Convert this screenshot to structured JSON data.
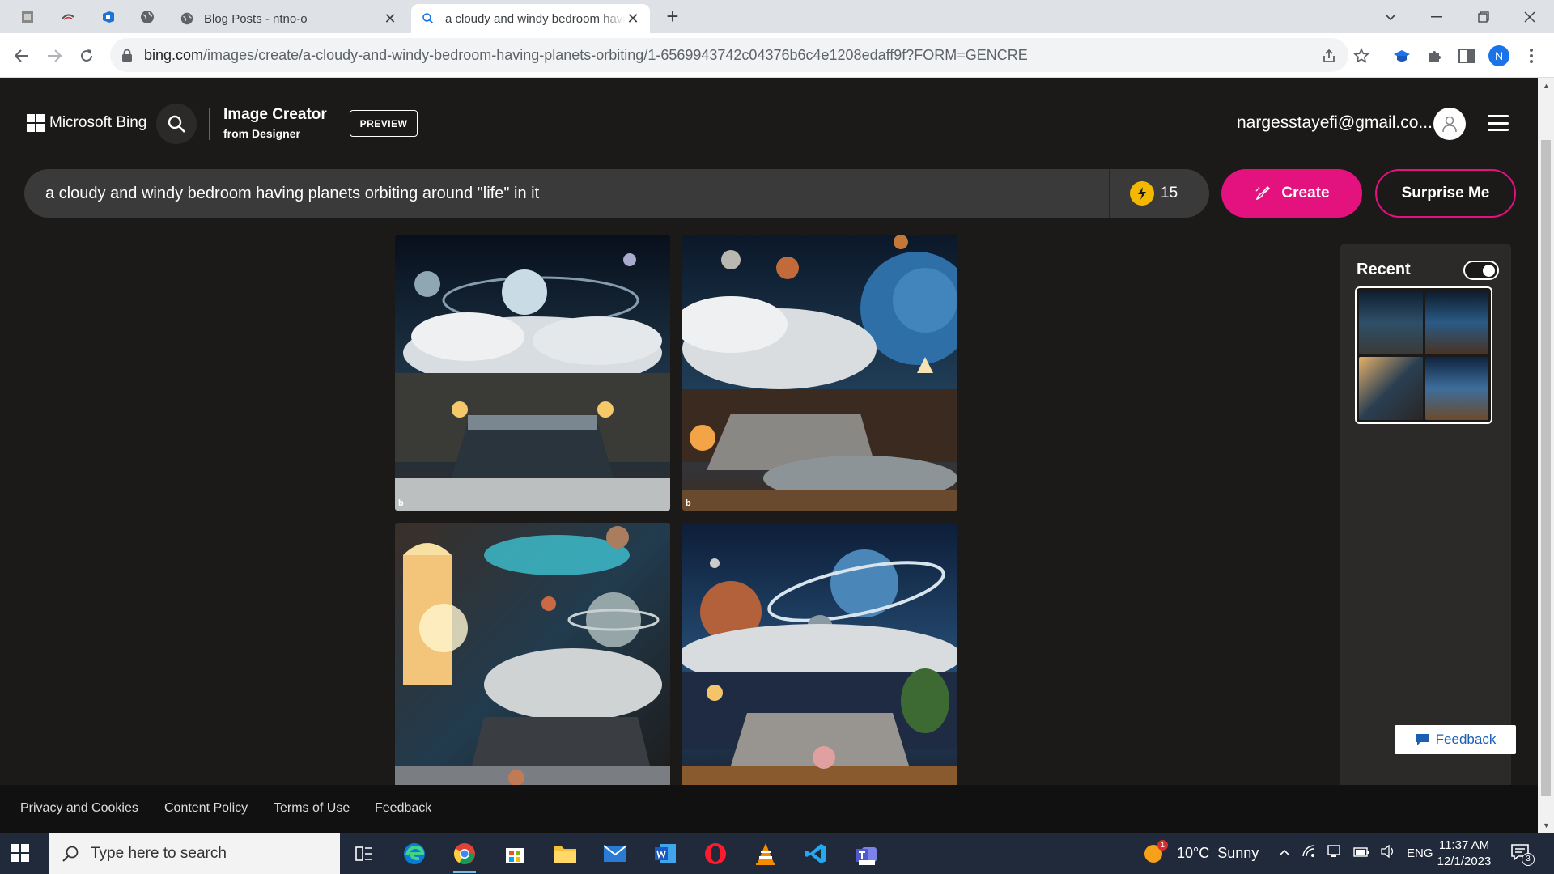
{
  "browser": {
    "tabs": [
      {
        "title": "Blog Posts - ntno-o",
        "active": false
      },
      {
        "title": "a cloudy and windy bedroom having planets orbiting",
        "active": true
      }
    ],
    "url_host": "bing.com",
    "url_path": "/images/create/a-cloudy-and-windy-bedroom-having-planets-orbiting/1-6569943742c04376b6c4e1208edaff9f?FORM=GENCRE",
    "profile_initial": "N"
  },
  "header": {
    "brand": "Microsoft Bing",
    "title": "Image Creator",
    "subtitle": "from Designer",
    "badge": "PREVIEW",
    "email": "nargesstayefi@gmail.co..."
  },
  "prompt": {
    "text": "a cloudy and windy bedroom having planets orbiting around \"life\" in it",
    "boosts": "15",
    "create_label": "Create",
    "surprise_label": "Surprise Me"
  },
  "results": {
    "images": [
      {
        "alt": "Bedroom with spiral galaxy and clouds"
      },
      {
        "alt": "Bedroom with blue planet and clouds"
      },
      {
        "alt": "Bedroom with window light and ringed planets"
      },
      {
        "alt": "Bedroom with ringed earth and clouds"
      }
    ],
    "watermark": "b"
  },
  "recent": {
    "title": "Recent",
    "toggle_on": true
  },
  "footer": {
    "links": [
      "Privacy and Cookies",
      "Content Policy",
      "Terms of Use",
      "Feedback"
    ],
    "feedback_button": "Feedback"
  },
  "taskbar": {
    "search_placeholder": "Type here to search",
    "weather_temp": "10°C",
    "weather_desc": "Sunny",
    "weather_badge": "1",
    "language": "ENG",
    "time": "11:37 AM",
    "date": "12/1/2023",
    "notifications": "3"
  },
  "colors": {
    "accent": "#e3127f",
    "page_bg": "#1b1a19",
    "boost": "#f5b800"
  }
}
